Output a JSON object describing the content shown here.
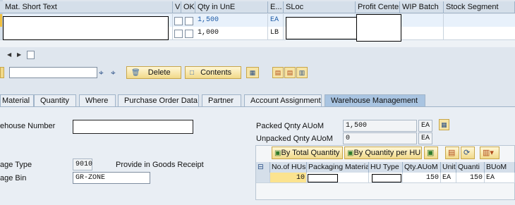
{
  "grid": {
    "headers": [
      "Mat. Short Text",
      "V",
      "OK",
      "Qty in UnE",
      "E...",
      "SLoc",
      "Profit Center",
      "WIP Batch",
      "Stock Segment"
    ],
    "rows": [
      {
        "qty": "1,500",
        "unit": "EA"
      },
      {
        "qty": "1,000",
        "unit": "LB"
      }
    ]
  },
  "toolbar": {
    "delete_label": "Delete",
    "contents_label": "Contents"
  },
  "tabs": [
    "Material",
    "Quantity",
    "Where",
    "Purchase Order Data",
    "Partner",
    "Account Assignment",
    "Warehouse Management"
  ],
  "wm": {
    "warehouse_number_label": "ehouse Number",
    "storage_type_label": "age Type",
    "storage_type_value": "9010",
    "storage_type_desc": "Provide in Goods Receipt",
    "storage_bin_label": "age Bin",
    "storage_bin_value": "GR-ZONE",
    "packed_label": "Packed Qnty AUoM",
    "packed_value": "1,500",
    "packed_unit": "EA",
    "unpacked_label": "Unpacked Qnty AUoM",
    "unpacked_value": "0",
    "unpacked_unit": "EA",
    "btn_total": "By Total Quantity",
    "btn_per_hu": "By Quantity per HU"
  },
  "hu_table": {
    "headers": [
      "No.of HUs",
      "Packaging Material",
      "HU Type",
      "Qty.AUoM",
      "Unit",
      "Quanti",
      "BUoM"
    ],
    "row": {
      "num": "10",
      "qty": "150",
      "unit": "EA",
      "quanti": "150",
      "buom": "EA"
    }
  }
}
